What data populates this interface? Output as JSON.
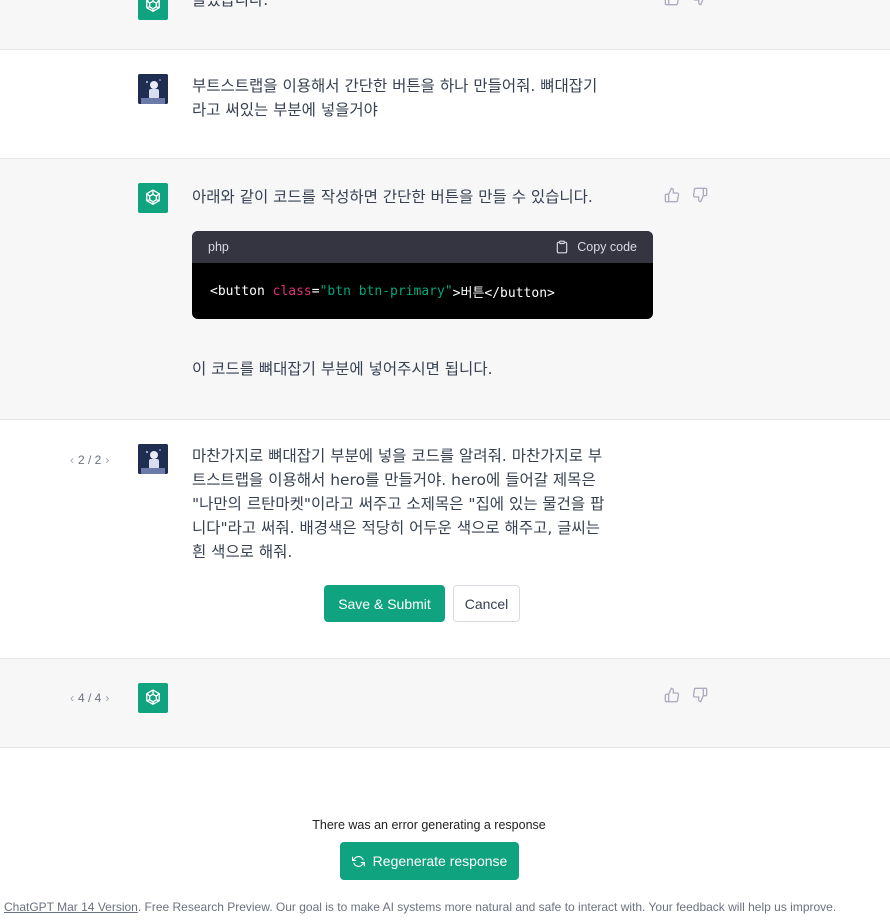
{
  "messages": {
    "prev_fragment": {
      "text": "들었습니다."
    },
    "user1": {
      "text_line1": "부트스트랩을 이용해서 간단한 버튼을 하나 만들어줘. 뼈대잡기",
      "text_line2": "라고 써있는 부분에 넣을거야"
    },
    "assistant1": {
      "intro": "아래와 같이 코드를 작성하면 간단한 버튼을 만들 수 있습니다.",
      "code": {
        "language": "php",
        "copy_label": "Copy code",
        "tag_open": "<button ",
        "attr_name": "class",
        "equals": "=",
        "attr_value": "\"btn btn-primary\"",
        "inner": ">버튼</button>"
      },
      "outro": "이 코드를 뼈대잡기 부분에 넣어주시면 됩니다."
    },
    "user2_edit": {
      "pager": "2 / 2",
      "line1": "마찬가지로 뼈대잡기 부분에 넣을 코드를 알려줘. 마찬가지로 부",
      "line2": "트스트랩을 이용해서 hero를 만들거야. hero에 들어갈 제목은",
      "line3": "\"나만의 르탄마켓\"이라고 써주고 소제목은 \"집에 있는 물건을 팝",
      "line4": "니다\"라고 써줘. 배경색은 적당히 어두운 색으로 해주고, 글씨는",
      "line5": "흰 색으로 해줘.",
      "save_label": "Save & Submit",
      "cancel_label": "Cancel"
    },
    "assistant2": {
      "pager": "4 / 4"
    }
  },
  "error": {
    "text": "There was an error generating a response",
    "regenerate_label": "Regenerate response"
  },
  "footer": {
    "link_text": "ChatGPT Mar 14 Version",
    "rest": ". Free Research Preview. Our goal is to make AI systems more natural and safe to interact with. Your feedback will help us improve."
  },
  "colors": {
    "accent": "#10a37f",
    "row_gray": "#f7f7f8",
    "code_bg": "#000000",
    "code_header": "#343541"
  },
  "icons": {
    "assistant_avatar": "openai-logo-icon",
    "user_avatar": "user-avatar-image",
    "thumbs_up": "thumbs-up-icon",
    "thumbs_down": "thumbs-down-icon",
    "copy": "clipboard-icon",
    "regenerate": "refresh-icon",
    "pager_prev": "chevron-left-icon",
    "pager_next": "chevron-right-icon"
  }
}
